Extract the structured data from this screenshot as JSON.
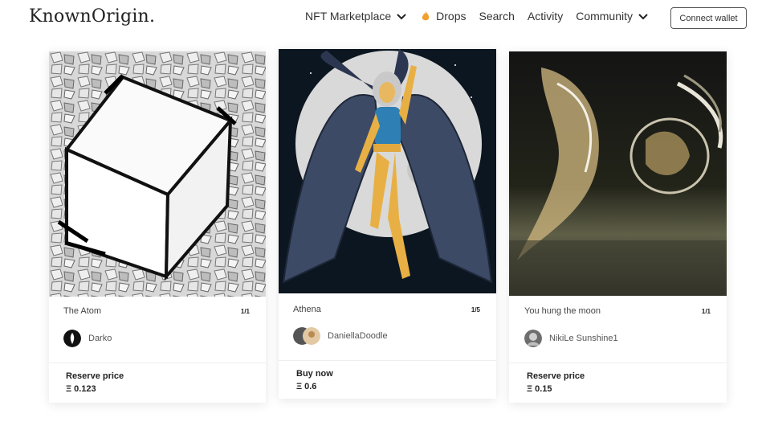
{
  "header": {
    "logo": "KnownOrigin",
    "logo_dot": ".",
    "nav": [
      {
        "label": "NFT Marketplace",
        "has_chevron": true
      },
      {
        "label": "Drops",
        "icon": "fire-icon"
      },
      {
        "label": "Search"
      },
      {
        "label": "Activity"
      },
      {
        "label": "Community",
        "has_chevron": true
      }
    ],
    "connect_label": "Connect wallet"
  },
  "cards": [
    {
      "title": "The Atom",
      "edition": "1/1",
      "artist": "Darko",
      "price_label": "Reserve price",
      "price": "Ξ 0.123"
    },
    {
      "title": "Athena",
      "edition": "1/5",
      "artist": "DaniellaDoodle",
      "price_label": "Buy now",
      "price": "Ξ 0.6"
    },
    {
      "title": "You hung the moon",
      "edition": "1/1",
      "artist": "NikiLe Sunshine1",
      "price_label": "Reserve price",
      "price": "Ξ 0.15"
    }
  ],
  "colors": {
    "accent": "#222222",
    "fire": "#f0a030"
  }
}
